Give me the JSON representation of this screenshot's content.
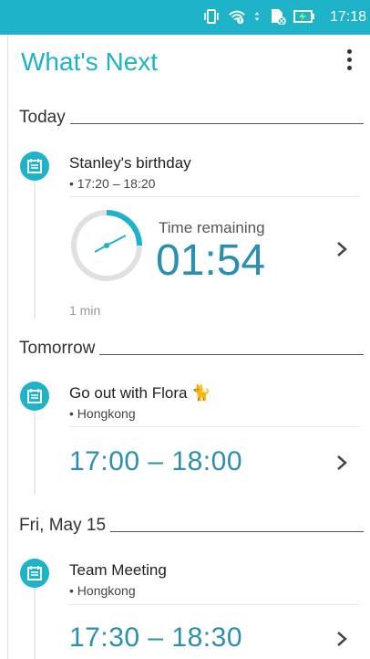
{
  "status": {
    "time": "17:18",
    "icons": [
      "vibrate-icon",
      "wifi-icon",
      "data-arrows-icon",
      "sim-icon",
      "battery-charging-icon"
    ]
  },
  "app": {
    "title": "What's Next",
    "menu_icon": "more-vert-icon"
  },
  "sections": [
    {
      "label": "Today"
    },
    {
      "label": "Tomorrow"
    },
    {
      "label": "Fri, May 15"
    }
  ],
  "events": [
    {
      "title": "Stanley's birthday",
      "subtitle": "• 17:20 – 18:20",
      "countdown": {
        "label": "Time remaining",
        "value": "01:54",
        "unit": "1 min",
        "progress": 0.25
      }
    },
    {
      "title": "Go out with Flora",
      "emoji": "🐈",
      "subtitle": "• Hongkong",
      "time_range": "17:00 – 18:00"
    },
    {
      "title": "Team Meeting",
      "subtitle": "• Hongkong",
      "time_range": "17:30 – 18:30"
    }
  ],
  "colors": {
    "accent": "#1fb3c9",
    "time": "#2a90ad"
  }
}
